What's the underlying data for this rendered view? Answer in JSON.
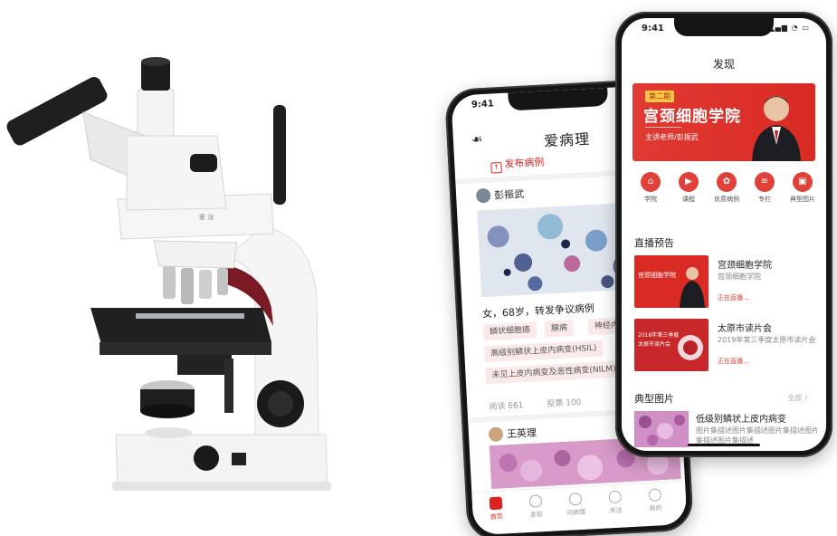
{
  "colors": {
    "accent": "#e0423a",
    "tag_bg": "#fbeaea",
    "microscope_body": "#f4f4f4",
    "microscope_accent": "#7a1a24"
  },
  "microscope": {
    "brand_label": "爱 派"
  },
  "back_phone": {
    "time": "9:41",
    "app_title": "爱病理",
    "publish_label": "发布病例",
    "post1": {
      "author": "彭振武",
      "case_title": "女，68岁，转发争议病例",
      "tags": [
        "鳞状细胞癌",
        "腺病",
        "神经内",
        "高级别鳞状上皮内病变(HSIL)",
        "未见上皮内病变及恶性病变(NILM)"
      ],
      "views": "阅读 661",
      "votes": "投票 100"
    },
    "post2": {
      "author": "王英理"
    },
    "tabs": [
      {
        "label": "首页",
        "icon": "home-icon",
        "active": true
      },
      {
        "label": "发现",
        "icon": "compass-icon",
        "active": false
      },
      {
        "label": "问病理",
        "icon": "chat-icon",
        "active": false
      },
      {
        "label": "关注",
        "icon": "heart-icon",
        "active": false
      },
      {
        "label": "我的",
        "icon": "user-icon",
        "active": false
      }
    ]
  },
  "front_phone": {
    "time": "9:41",
    "nav_title": "发现",
    "banner": {
      "badge": "第二期",
      "title": "宫颈细胞学院",
      "subtitle": "主讲老师/彭振武"
    },
    "quick_icons": [
      {
        "label": "学院",
        "icon": "academy-icon"
      },
      {
        "label": "课程",
        "icon": "play-icon"
      },
      {
        "label": "优质病例",
        "icon": "star-icon"
      },
      {
        "label": "专栏",
        "icon": "column-icon"
      },
      {
        "label": "典型图片",
        "icon": "image-icon"
      }
    ],
    "live_section_title": "直播预告",
    "live_items": [
      {
        "title": "宫颈细胞学院",
        "desc": "宫颈细胞学院",
        "status": "正在直播..."
      },
      {
        "title": "太原市读片会",
        "desc": "2019年第三季度太原市读片会",
        "status": "正在直播..."
      }
    ],
    "typical_section_title": "典型图片",
    "all_label": "全部 〉",
    "typical_item": {
      "title": "低级别鳞状上皮内病变",
      "desc": "图片集描述图片集描述图片集描述图片集描述图片集描述"
    }
  }
}
